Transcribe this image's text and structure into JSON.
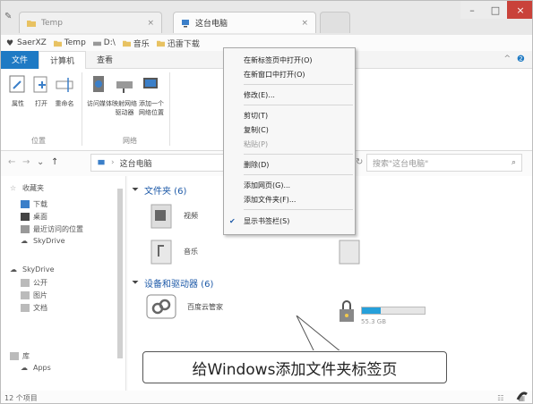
{
  "tabs": [
    {
      "label": "Temp"
    },
    {
      "label": "这台电脑"
    }
  ],
  "favorites": [
    "SaerXZ",
    "Temp",
    "D:\\",
    "音乐",
    "迅雷下载"
  ],
  "ribbon_tabs": [
    "文件",
    "计算机",
    "查看"
  ],
  "ribbon": {
    "buttons": [
      "属性",
      "打开",
      "重命名",
      "访问媒体",
      "映射网络\n驱动器",
      "添加一个\n网络位置"
    ],
    "groups": [
      "位置",
      "网络"
    ]
  },
  "address": {
    "path": "这台电脑",
    "search_placeholder": "搜索\"这台电脑\""
  },
  "nav": {
    "favorites_title": "收藏夹",
    "favorites_items": [
      "下载",
      "桌面",
      "最近访问的位置",
      "SkyDrive"
    ],
    "skydrive_title": "SkyDrive",
    "skydrive_items": [
      "公开",
      "图片",
      "文档"
    ],
    "library_title": "库",
    "library_items": [
      "Apps"
    ]
  },
  "content": {
    "folders_header": "文件夹 (6)",
    "folders": [
      "视频",
      "音乐"
    ],
    "devices_header": "设备和驱动器 (6)",
    "devices": [
      "百度云管家"
    ],
    "drive_size": "55.3 GB"
  },
  "status": {
    "count": "12 个项目"
  },
  "context_menu": {
    "items": [
      {
        "label": "在新标签页中打开(O)",
        "disabled": false,
        "checked": false
      },
      {
        "label": "在新窗口中打开(O)",
        "disabled": false,
        "checked": false
      },
      {
        "label": "修改(E)...",
        "disabled": false,
        "checked": false
      },
      {
        "label": "剪切(T)",
        "disabled": false,
        "checked": false
      },
      {
        "label": "复制(C)",
        "disabled": false,
        "checked": false
      },
      {
        "label": "粘贴(P)",
        "disabled": true,
        "checked": false
      },
      {
        "label": "删除(D)",
        "disabled": false,
        "checked": false
      },
      {
        "label": "添加网页(G)...",
        "disabled": false,
        "checked": false
      },
      {
        "label": "添加文件夹(F)...",
        "disabled": false,
        "checked": false
      },
      {
        "label": "显示书签栏(S)",
        "disabled": false,
        "checked": true
      }
    ]
  },
  "caption": "给Windows添加文件夹标签页",
  "colors": {
    "accent": "#1e7ac4",
    "close": "#c9423a"
  }
}
